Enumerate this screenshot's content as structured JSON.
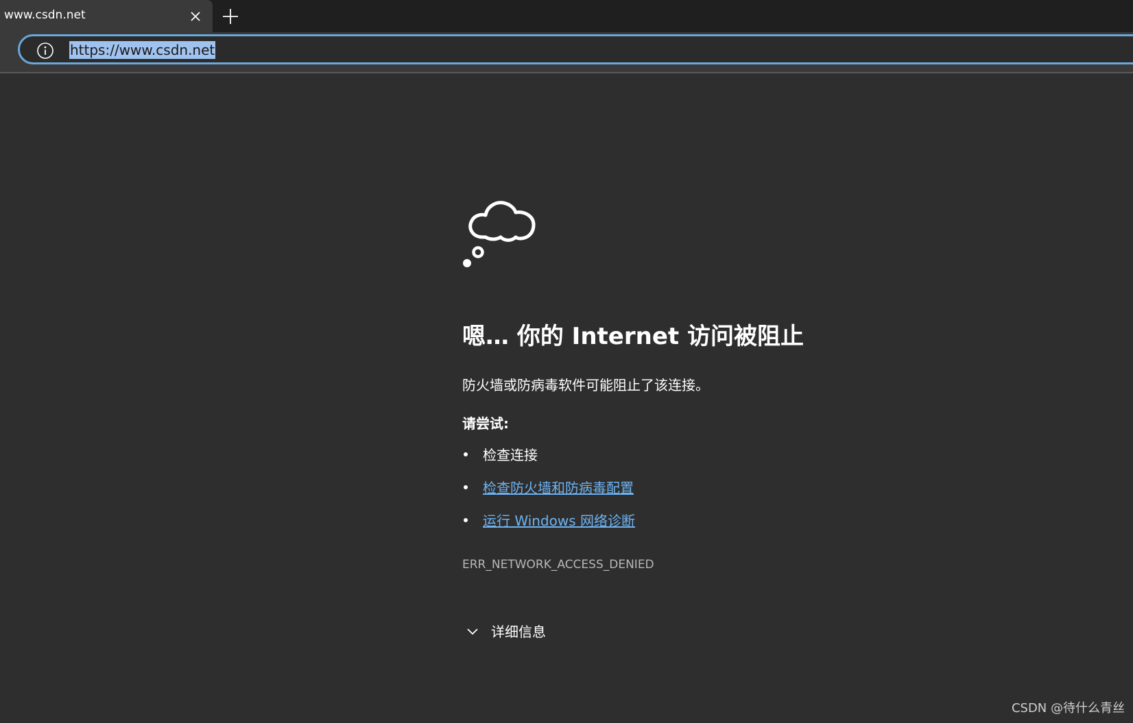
{
  "tab": {
    "title": "www.csdn.net"
  },
  "address_bar": {
    "url": "https://www.csdn.net"
  },
  "error_page": {
    "heading": "嗯… 你的 Internet 访问被阻止",
    "description": "防火墙或防病毒软件可能阻止了该连接。",
    "try_label": "请尝试:",
    "suggestions": [
      {
        "text": "检查连接",
        "link": false
      },
      {
        "text": "检查防火墙和防病毒配置",
        "link": true
      },
      {
        "text": "运行 Windows 网络诊断",
        "link": true
      }
    ],
    "error_code": "ERR_NETWORK_ACCESS_DENIED",
    "details_label": "详细信息"
  },
  "watermark": "CSDN @待什么青丝",
  "icons": {
    "tab_close": "close-icon",
    "new_tab": "plus-icon",
    "site_info": "info-icon",
    "error_illustration": "thought-cloud-icon",
    "details_toggle": "chevron-down-icon"
  },
  "colors": {
    "page_background": "#2e2e2e",
    "link": "#6db3f2",
    "omnibox_focus_border": "#6ba8dc",
    "url_selection": "#9fc2ef"
  }
}
